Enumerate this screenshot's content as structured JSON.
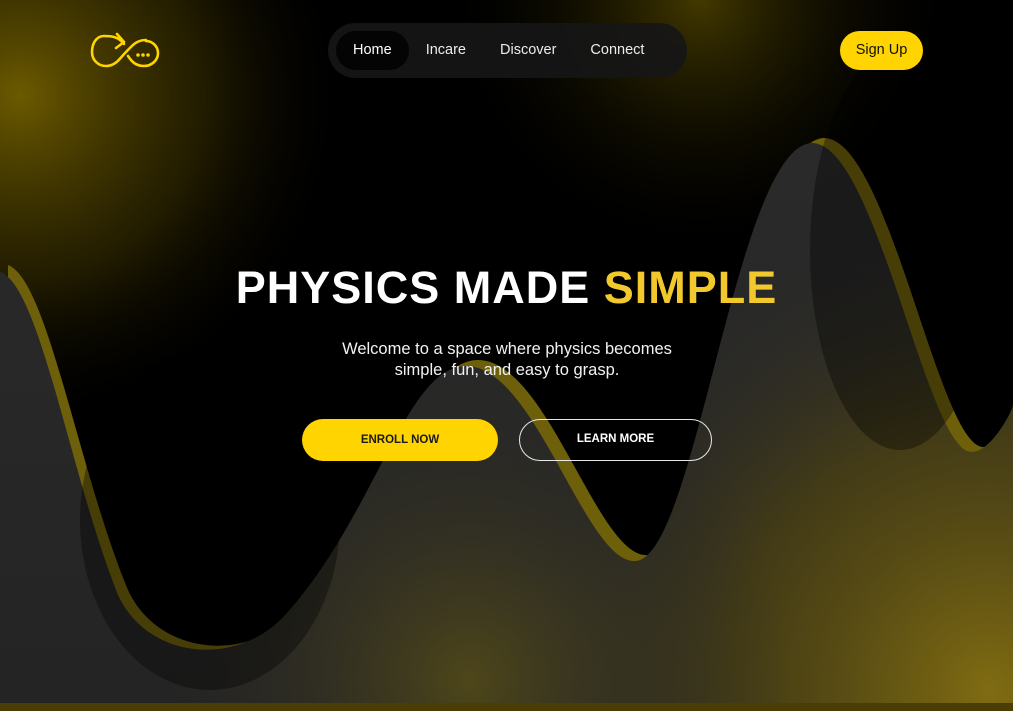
{
  "header": {
    "logo_icon": "infinity-arrow-chat-icon",
    "nav": [
      {
        "label": "Home",
        "active": true
      },
      {
        "label": "Incare",
        "active": false
      },
      {
        "label": "Discover",
        "active": false
      },
      {
        "label": "Connect",
        "active": false
      }
    ],
    "signup_label": "Sign Up"
  },
  "hero": {
    "title_main": "PHYSICS MADE ",
    "title_accent": "SIMPLE",
    "subtitle_line1": "Welcome to a space where physics becomes",
    "subtitle_line2": "simple, fun, and easy to grasp.",
    "enroll_label": "ENROLL NOW",
    "learn_label": "LEARN MORE"
  },
  "colors": {
    "accent_yellow": "#ffd400",
    "title_accent": "#f2c92c",
    "background": "#000000",
    "wave_fill": "#262626",
    "wave_edge": "#7a6a08"
  }
}
